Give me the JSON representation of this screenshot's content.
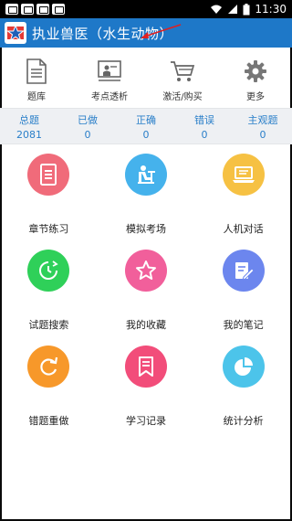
{
  "status_bar": {
    "time": "11:30"
  },
  "app_bar": {
    "title": "执业兽医（水生动物）"
  },
  "top_menu": [
    {
      "label": "题库",
      "icon": "document-icon"
    },
    {
      "label": "考点透析",
      "icon": "presentation-icon"
    },
    {
      "label": "激活/购买",
      "icon": "cart-icon"
    },
    {
      "label": "更多",
      "icon": "gear-icon"
    }
  ],
  "stats": [
    {
      "key": "总题",
      "value": "2081"
    },
    {
      "key": "已做",
      "value": "0"
    },
    {
      "key": "正确",
      "value": "0"
    },
    {
      "key": "错误",
      "value": "0"
    },
    {
      "key": "主观题",
      "value": "0"
    }
  ],
  "features": [
    {
      "label": "章节练习",
      "icon": "document-icon",
      "color": "#f06b7a"
    },
    {
      "label": "模拟考场",
      "icon": "exam-seat-icon",
      "color": "#45b2ec"
    },
    {
      "label": "人机对话",
      "icon": "laptop-icon",
      "color": "#f6c143"
    },
    {
      "label": "试题搜索",
      "icon": "search-clock-icon",
      "color": "#2fd059"
    },
    {
      "label": "我的收藏",
      "icon": "star-icon",
      "color": "#f15f9b"
    },
    {
      "label": "我的笔记",
      "icon": "note-edit-icon",
      "color": "#6c86ee"
    },
    {
      "label": "错题重做",
      "icon": "redo-icon",
      "color": "#f7982a"
    },
    {
      "label": "学习记录",
      "icon": "bookmark-icon",
      "color": "#f24d7a"
    },
    {
      "label": "统计分析",
      "icon": "pie-chart-icon",
      "color": "#4cc4ea"
    }
  ]
}
